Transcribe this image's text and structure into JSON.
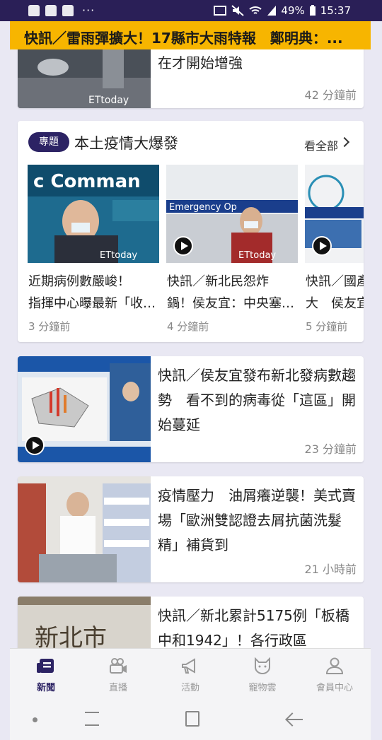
{
  "status_bar": {
    "battery": "49%",
    "time": "15:37",
    "overflow": "···"
  },
  "ticker": {
    "text": "快訊／雷雨彈擴大！17縣市大雨特報　鄭明典：..."
  },
  "feed": {
    "top_article": {
      "title": "在才開始增強",
      "time": "42 分鐘前"
    },
    "topic": {
      "badge": "專題",
      "title": "本土疫情大爆發",
      "see_all": "看全部",
      "items": [
        {
          "title_line1": "近期病例數嚴峻！",
          "title_line2": "指揮中心曝最新「收…",
          "time": "3 分鐘前",
          "video": false
        },
        {
          "title_line1": "快訊／新北民怨炸",
          "title_line2": "鍋！侯友宜：中央塞…",
          "time": "4 分鐘前",
          "video": true
        },
        {
          "title_line1": "快訊／國產",
          "title_line2": "大　侯友宜",
          "time": "5 分鐘前",
          "video": true
        }
      ]
    },
    "articles": [
      {
        "title": "快訊／侯友宜發布新北發病數趨勢　看不到的病毒從「這區」開始蔓延",
        "time": "23 分鐘前",
        "video": true
      },
      {
        "title": "疫情壓力　油屑癢逆襲！美式賣場「歐洲雙認證去屑抗菌洗髮精」補貨到",
        "time": "21 小時前",
        "video": false
      },
      {
        "title": "快訊／新北累計5175例「板橋中和1942」！各行政區",
        "time": "",
        "video": false
      }
    ]
  },
  "bottom_nav": {
    "items": [
      {
        "label": "新聞",
        "icon": "news-icon",
        "active": true
      },
      {
        "label": "直播",
        "icon": "live-camera-icon",
        "active": false
      },
      {
        "label": "活動",
        "icon": "megaphone-icon",
        "active": false
      },
      {
        "label": "寵物雲",
        "icon": "cat-icon",
        "active": false
      },
      {
        "label": "會員中心",
        "icon": "user-icon",
        "active": false
      }
    ]
  },
  "colors": {
    "brand": "#2c2364",
    "ticker": "#f7b500",
    "background": "#e9e8f3"
  }
}
